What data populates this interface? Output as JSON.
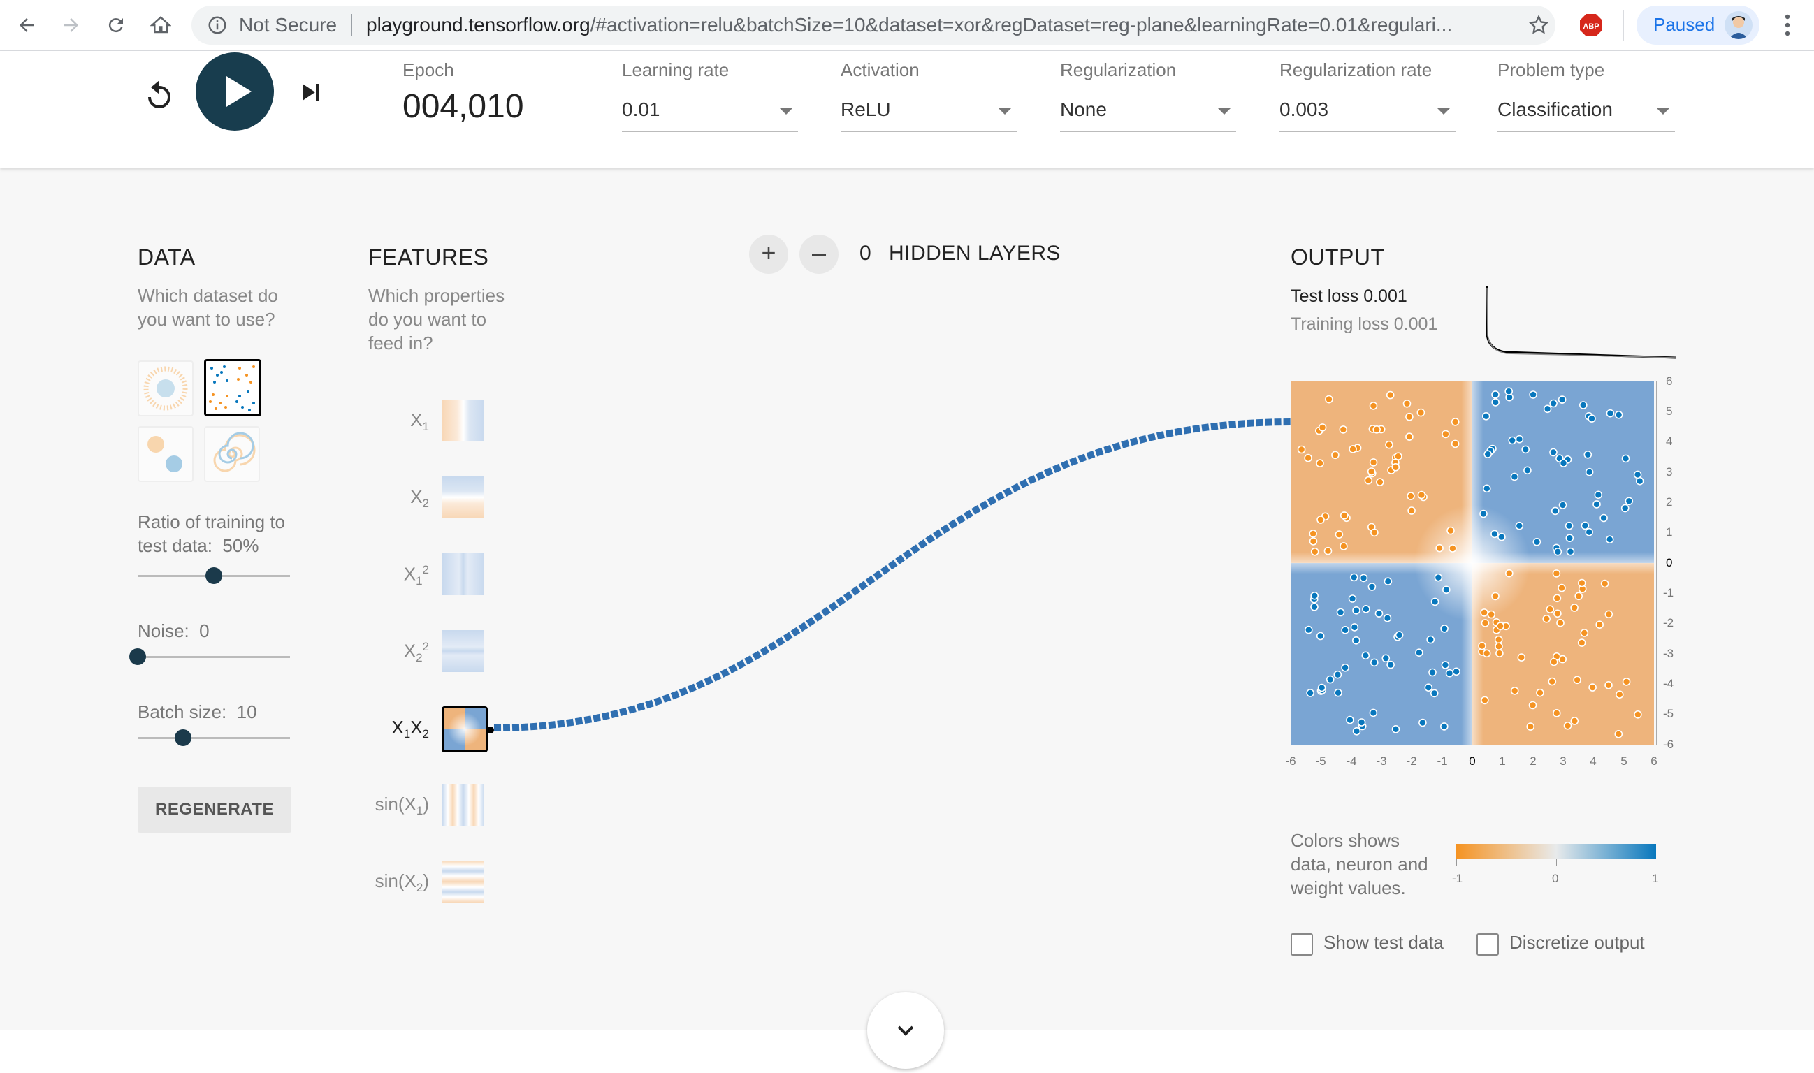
{
  "browser": {
    "security_label": "Not Secure",
    "url_domain": "playground.tensorflow.org",
    "url_rest": "/#activation=relu&batchSize=10&dataset=xor&regDataset=reg-plane&learningRate=0.01&regulari...",
    "profile_label": "Paused",
    "adblock_label": "ABP"
  },
  "controls": {
    "epoch_label": "Epoch",
    "epoch_value": "004,010",
    "learning_rate": {
      "label": "Learning rate",
      "value": "0.01"
    },
    "activation": {
      "label": "Activation",
      "value": "ReLU"
    },
    "regularization": {
      "label": "Regularization",
      "value": "None"
    },
    "regularization_rate": {
      "label": "Regularization rate",
      "value": "0.003"
    },
    "problem_type": {
      "label": "Problem type",
      "value": "Classification"
    }
  },
  "data_panel": {
    "title": "DATA",
    "subtitle_line1": "Which dataset do",
    "subtitle_line2": "you want to use?",
    "ratio_label_line1": "Ratio of training to",
    "ratio_label_line2": "test data:",
    "ratio_value": "50%",
    "ratio_fraction": 0.5,
    "noise_label": "Noise:",
    "noise_value": "0",
    "noise_fraction": 0.0,
    "batch_label": "Batch size:",
    "batch_value": "10",
    "batch_fraction": 0.3,
    "regenerate_label": "REGENERATE"
  },
  "features_panel": {
    "title": "FEATURES",
    "subtitle_line1": "Which properties",
    "subtitle_line2": "do you want to",
    "subtitle_line3": "feed in?",
    "features": [
      {
        "base": "X",
        "sub": "1",
        "sup": "",
        "suffix": "",
        "active": false
      },
      {
        "base": "X",
        "sub": "2",
        "sup": "",
        "suffix": "",
        "active": false
      },
      {
        "base": "X",
        "sub": "1",
        "sup": "2",
        "suffix": "",
        "active": false
      },
      {
        "base": "X",
        "sub": "2",
        "sup": "2",
        "suffix": "",
        "active": false
      },
      {
        "base": "X",
        "sub": "1",
        "sup": "",
        "suffix": "X2",
        "active": true
      },
      {
        "base": "sin(X",
        "sub": "1",
        "sup": "",
        "suffix": ")",
        "active": false
      },
      {
        "base": "sin(X",
        "sub": "2",
        "sup": "",
        "suffix": ")",
        "active": false
      }
    ]
  },
  "network": {
    "hidden_layers_count": "0",
    "hidden_layers_label": "HIDDEN LAYERS",
    "add_symbol": "+",
    "remove_symbol": "–"
  },
  "output_panel": {
    "title": "OUTPUT",
    "test_loss": "Test loss 0.001",
    "training_loss": "Training loss 0.001",
    "y_ticks": [
      "6",
      "5",
      "4",
      "3",
      "2",
      "1",
      "0",
      "-1",
      "-2",
      "-3",
      "-4",
      "-5",
      "-6"
    ],
    "x_ticks": [
      "-6",
      "-5",
      "-4",
      "-3",
      "-2",
      "-1",
      "0",
      "1",
      "2",
      "3",
      "4",
      "5",
      "6"
    ],
    "legend_line1": "Colors shows",
    "legend_line2": "data, neuron and",
    "legend_line3": "weight values.",
    "scale_min": "-1",
    "scale_mid": "0",
    "scale_max": "1",
    "show_test_label": "Show test data",
    "discretize_label": "Discretize output"
  },
  "colors": {
    "orange": "#f59322",
    "blue": "#0877bd",
    "region_orange": "#eeb47c",
    "region_blue": "#7aa5d3",
    "play_button": "#183d4e"
  }
}
